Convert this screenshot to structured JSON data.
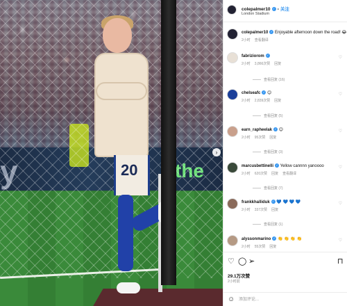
{
  "post": {
    "author": "colepalmer10",
    "follow_label": "关注",
    "location": "London Stadium",
    "caption": "Enjoyable afternoon down the road! 😂",
    "caption_meta": "2小时",
    "caption_translate": "查看翻译",
    "likes": "29.1万次赞",
    "time_ago": "2小时前",
    "comment_placeholder": "添加评论..."
  },
  "comments": [
    {
      "user": "fabriziorom",
      "verified": true,
      "text": "",
      "time": "2小时",
      "likes": "3,866次赞",
      "reply": "回复",
      "replies": "查看回复 (16)"
    },
    {
      "user": "chelseafc",
      "verified": true,
      "text": "😊",
      "time": "2小时",
      "likes": "2,839次赞",
      "reply": "回复",
      "replies": "查看回复 (5)"
    },
    {
      "user": "earn_rapheelak",
      "verified": true,
      "text": "😊",
      "time": "2小时",
      "likes": "95次赞",
      "reply": "回复",
      "replies": "查看回复 (3)"
    },
    {
      "user": "marcusbettinelli",
      "verified": true,
      "text": "Yellow cannnn yanoooo",
      "time": "2小时",
      "likes": "620次赞",
      "reply": "回复",
      "translate": "查看翻译",
      "replies": "查看回复 (7)"
    },
    {
      "user": "frankkhalliduk",
      "verified": true,
      "text": "💙 💙 💙 💙",
      "time": "2小时",
      "likes": "337次赞",
      "reply": "回复",
      "replies": "查看回复 (1)"
    },
    {
      "user": "alyssonmarino",
      "verified": true,
      "text": "👏 👏 👏 👏",
      "time": "2小时",
      "likes": "55次赞",
      "reply": "回复"
    }
  ],
  "icons": [
    "heart-icon",
    "comment-icon",
    "share-icon",
    "bookmark-icon",
    "emoji-icon",
    "more-icon"
  ],
  "colors": {
    "verified": "#3897f0",
    "follow": "#3897f0",
    "meta": "#8e8e8e"
  }
}
